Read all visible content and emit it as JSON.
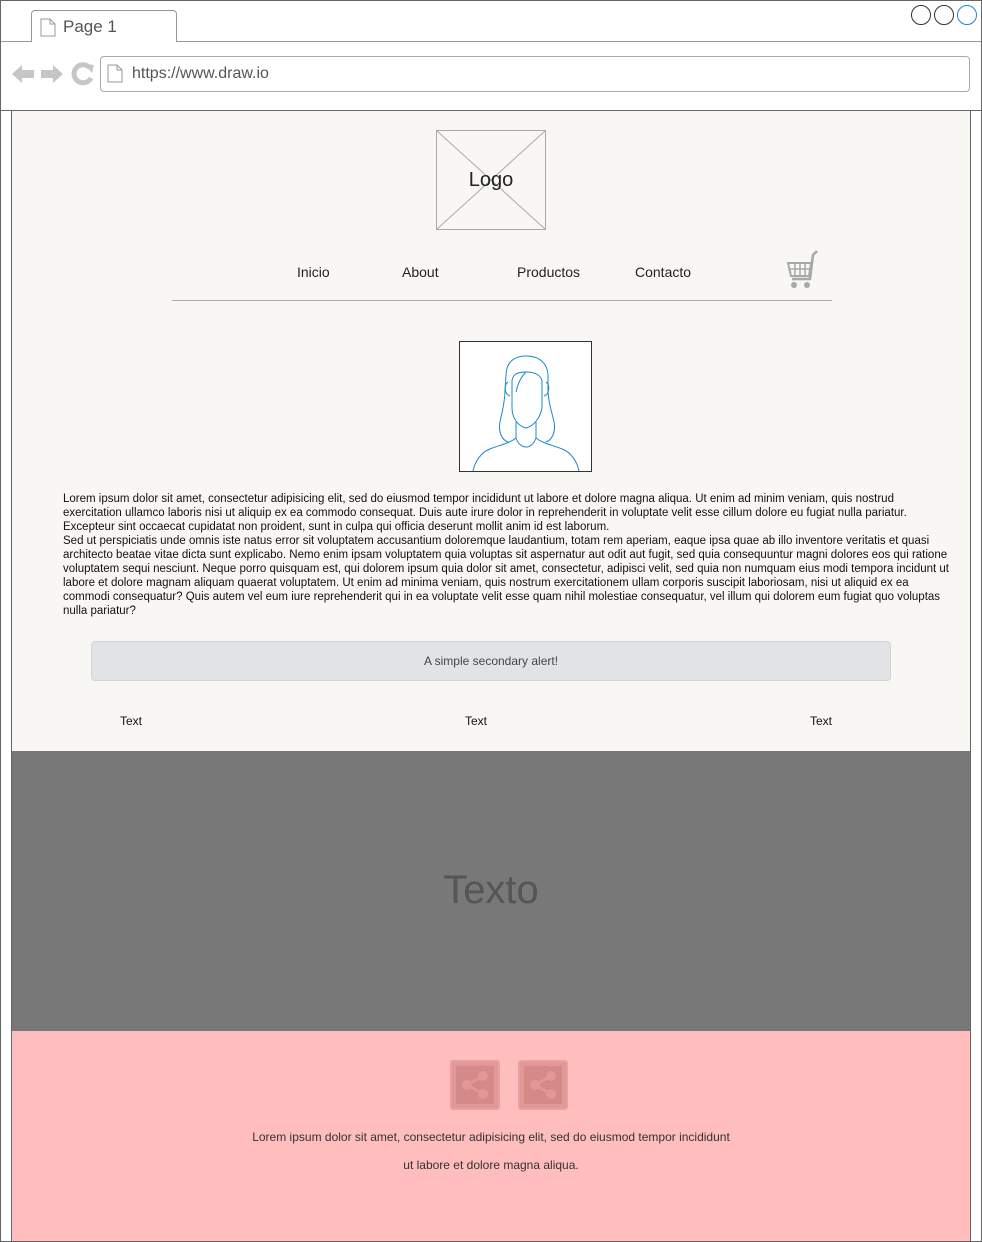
{
  "browser": {
    "tab_title": "Page 1",
    "url": "https://www.draw.io"
  },
  "header": {
    "logo_text": "Logo",
    "menu": [
      {
        "label": "Inicio"
      },
      {
        "label": "About"
      },
      {
        "label": "Productos"
      },
      {
        "label": "Contacto"
      }
    ]
  },
  "content": {
    "paragraph_1": "Lorem ipsum dolor sit amet, consectetur adipisicing elit, sed do eiusmod tempor incididunt ut labore et dolore magna aliqua. Ut enim ad minim veniam, quis nostrud exercitation ullamco laboris nisi ut aliquip ex ea commodo consequat. Duis aute irure dolor in reprehenderit in voluptate velit esse cillum dolore eu fugiat nulla pariatur. Excepteur sint occaecat cupidatat non proident, sunt in culpa qui officia deserunt mollit anim id est laborum.",
    "paragraph_2": "Sed ut perspiciatis unde omnis iste natus error sit voluptatem accusantium doloremque laudantium, totam rem aperiam, eaque ipsa quae ab illo inventore veritatis et quasi architecto beatae vitae dicta sunt explicabo. Nemo enim ipsam voluptatem quia voluptas sit aspernatur aut odit aut fugit, sed quia consequuntur magni dolores eos qui ratione voluptatem sequi nesciunt. Neque porro quisquam est, qui dolorem ipsum quia dolor sit amet, consectetur, adipisci velit, sed quia non numquam eius modi tempora incidunt ut labore et dolore magnam aliquam quaerat voluptatem. Ut enim ad minima veniam, quis nostrum exercitationem ullam corporis suscipit laboriosam, nisi ut aliquid ex ea commodi consequatur? Quis autem vel eum iure reprehenderit qui in ea voluptate velit esse quam nihil molestiae consequatur, vel illum qui dolorem eum fugiat quo voluptas nulla pariatur?",
    "alert_text": "A simple secondary alert!",
    "text_labels": [
      "Text",
      "Text",
      "Text"
    ]
  },
  "banner": {
    "text": "Texto"
  },
  "footer": {
    "line_1": "Lorem ipsum dolor sit amet, consectetur adipisicing elit, sed do eiusmod tempor incididunt",
    "line_2": "ut labore et dolore magna aliqua."
  },
  "colors": {
    "content_bg": "#f9f7f3",
    "banner_bg": "#787878",
    "footer_bg": "#ffbdbd",
    "alert_bg": "#e2e3e5",
    "avatar_stroke": "#1e88c8"
  },
  "icons": [
    "document-icon",
    "back-arrow-icon",
    "forward-arrow-icon",
    "reload-icon",
    "cart-icon",
    "share-icon",
    "avatar-placeholder-icon"
  ]
}
